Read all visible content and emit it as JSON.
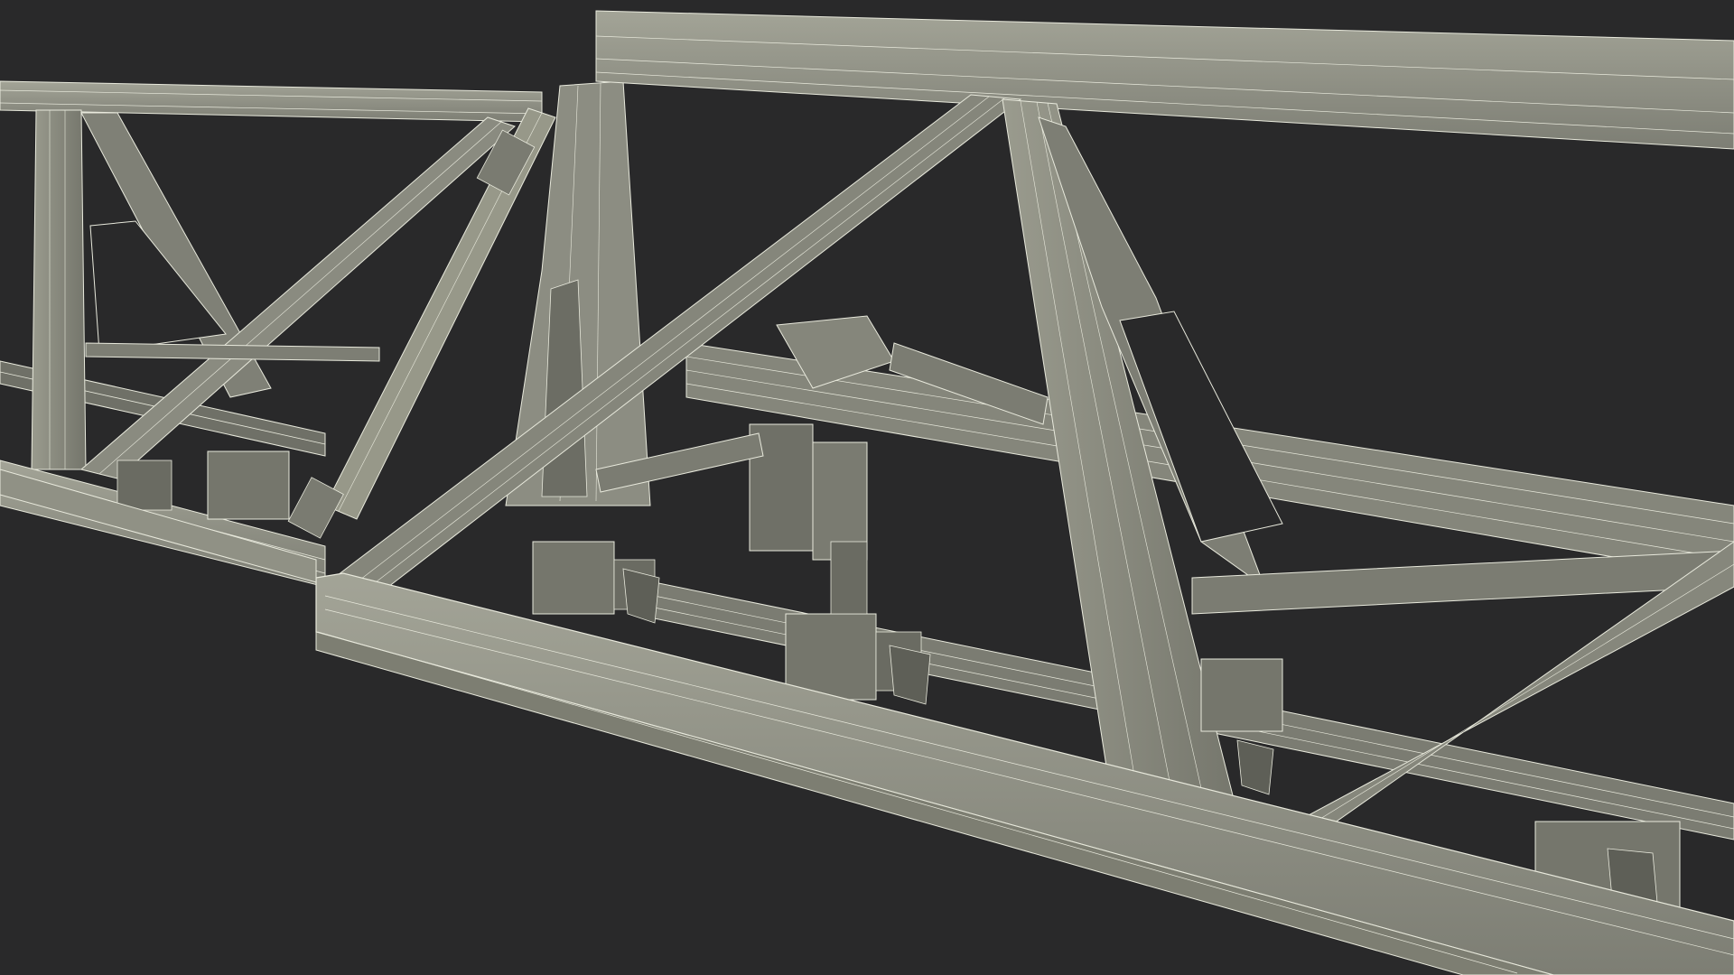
{
  "scene": {
    "background_color": "#29292a",
    "surface_color": "#8a8b80",
    "surface_shade_color": "#6f7067",
    "surface_light_color": "#a3a497",
    "wire_color": "#e8e9dc",
    "edge_color": "#3a3b36",
    "render_style": "wireframe-over-shaded",
    "subject": "boom-sprayer-truss-section"
  }
}
